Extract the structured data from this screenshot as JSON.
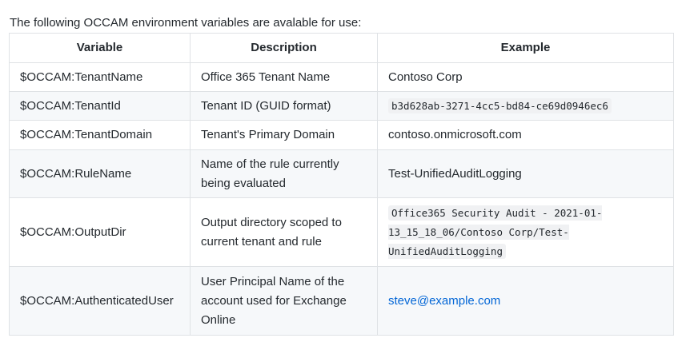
{
  "intro": "The following OCCAM environment variables are avalable for use:",
  "table": {
    "headers": [
      "Variable",
      "Description",
      "Example"
    ],
    "rows": [
      {
        "variable": "$OCCAM:TenantName",
        "description": "Office 365 Tenant Name",
        "example": "Contoso Corp",
        "example_style": "text"
      },
      {
        "variable": "$OCCAM:TenantId",
        "description": "Tenant ID (GUID format)",
        "example": "b3d628ab-3271-4cc5-bd84-ce69d0946ec6",
        "example_style": "code"
      },
      {
        "variable": "$OCCAM:TenantDomain",
        "description": "Tenant's Primary Domain",
        "example": "contoso.onmicrosoft.com",
        "example_style": "text"
      },
      {
        "variable": "$OCCAM:RuleName",
        "description": "Name of the rule currently being evaluated",
        "example": "Test-UnifiedAuditLogging",
        "example_style": "text"
      },
      {
        "variable": "$OCCAM:OutputDir",
        "description": "Output directory scoped to current tenant and rule",
        "example": "Office365 Security Audit - 2021-01-13_15_18_06/Contoso Corp/Test-UnifiedAuditLogging",
        "example_style": "code"
      },
      {
        "variable": "$OCCAM:AuthenticatedUser",
        "description": "User Principal Name of the account used for Exchange Online",
        "example": "steve@example.com",
        "example_style": "link"
      }
    ]
  },
  "colors": {
    "border": "#dfe2e5",
    "stripe": "#f6f8fa",
    "link": "#0366d6",
    "text": "#24292e"
  }
}
